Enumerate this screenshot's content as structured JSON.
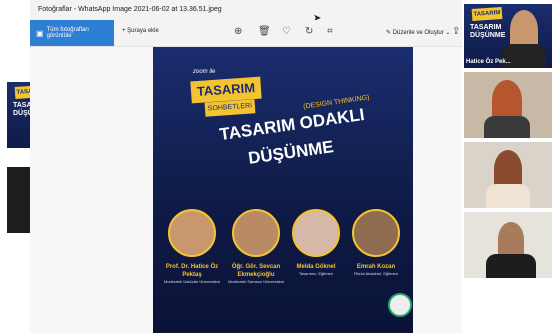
{
  "window": {
    "title": "Fotoğraflar - WhatsApp Image 2021-06-02 at 13.36.51.jpeg"
  },
  "toolbar": {
    "all_photos": "Tüm fotoğrafları görüntüle",
    "add_to": "Şuraya ekle",
    "edit_create": "Düzenle ve Oluştur",
    "icons": [
      "zoom-icon",
      "delete-icon",
      "favorite-icon",
      "rotate-icon",
      "crop-icon",
      "edit-icon",
      "share-icon"
    ]
  },
  "poster": {
    "zoom_label": "zoom ile",
    "badge_line1": "TASARIM",
    "badge_line2": "SOHBETLERİ",
    "design_thinking": "(DESIGN THINKING)",
    "headline1": "TASARIM ODAKLI",
    "headline2": "DÜŞÜNME",
    "speakers": [
      {
        "name": "Prof. Dr. Hatice Öz Pektaş",
        "role": "Moderatör Üsküdar Üniversitesi"
      },
      {
        "name": "Öğr. Gör. Sevcan Ekmekçioğlu",
        "role": "Moderatör Samsun Üniversitesi"
      },
      {
        "name": "Melda Göknel",
        "role": "Tasarımcı, Eğitmen"
      },
      {
        "name": "Emrah Kozan",
        "role": "Fikrial Akademi, Eğitmen"
      }
    ],
    "colors": {
      "accent": "#f4c430",
      "background": "#0f1b47"
    }
  },
  "video": {
    "tiles": [
      {
        "name": "Hatice Öz Pek..."
      }
    ]
  }
}
